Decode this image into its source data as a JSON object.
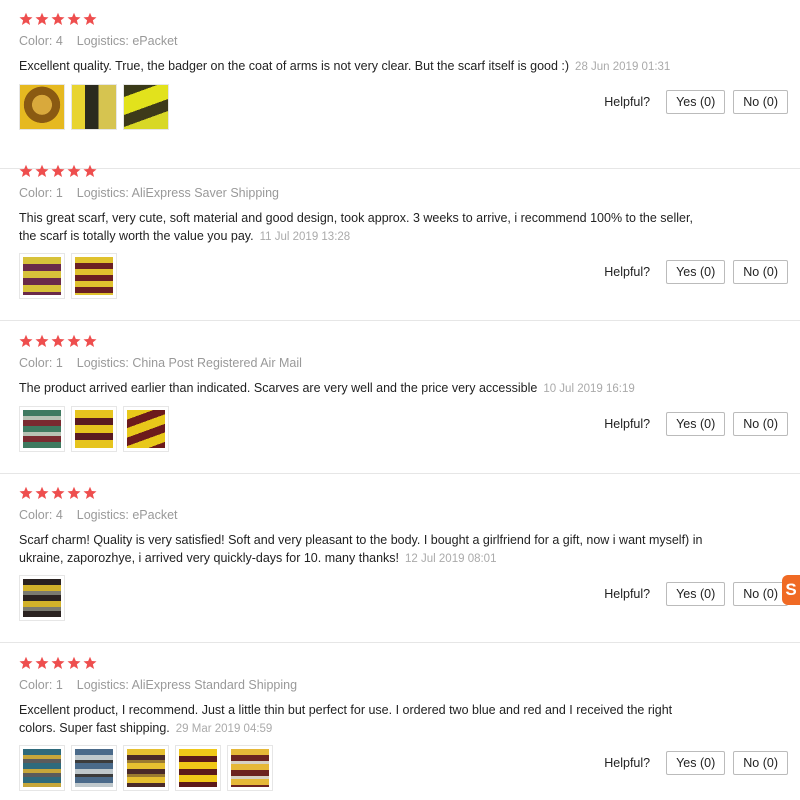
{
  "helpful_label": "Helpful?",
  "colors": {
    "star": "#ee4e4e",
    "meta": "#999999",
    "date": "#aaaaaa",
    "badge": "#f06a24"
  },
  "side_badge": {
    "glyph": "S"
  },
  "reviews": [
    {
      "rating": 5,
      "color": "Color: 4",
      "logistics": "Logistics: ePacket",
      "text": "Excellent quality. True, the badger on the coat of arms is not very clear. But the scarf itself is good :)",
      "date": "28 Jun 2019 01:31",
      "yes": "Yes (0)",
      "no": "No (0)"
    },
    {
      "rating": 5,
      "color": "Color: 1",
      "logistics": "Logistics: AliExpress Saver Shipping",
      "text": "This great scarf, very cute, soft material and good design, took approx. 3 weeks to arrive, i recommend 100% to the seller, the scarf is totally worth the value you pay.",
      "date": "11 Jul 2019 13:28",
      "yes": "Yes (0)",
      "no": "No (0)"
    },
    {
      "rating": 5,
      "color": "Color: 1",
      "logistics": "Logistics: China Post Registered Air Mail",
      "text": "The product arrived earlier than indicated. Scarves are very well and the price very accessible",
      "date": "10 Jul 2019 16:19",
      "yes": "Yes (0)",
      "no": "No (0)"
    },
    {
      "rating": 5,
      "color": "Color: 4",
      "logistics": "Logistics: ePacket",
      "text": "Scarf charm! Quality is very satisfied! Soft and very pleasant to the body. I bought a girlfriend for a gift, now i want myself) in ukraine, zaporozhye, i arrived very quickly-days for 10. many thanks!",
      "date": "12 Jul 2019 08:01",
      "yes": "Yes (0)",
      "no": "No (0)"
    },
    {
      "rating": 5,
      "color": "Color: 1",
      "logistics": "Logistics: AliExpress Standard Shipping",
      "text": "Excellent product, I recommend. Just a little thin but perfect for use. I ordered two blue and red and I received the right colors. Super fast shipping.",
      "date": "29 Mar 2019 04:59",
      "yes": "Yes (0)",
      "no": "No (0)"
    }
  ]
}
